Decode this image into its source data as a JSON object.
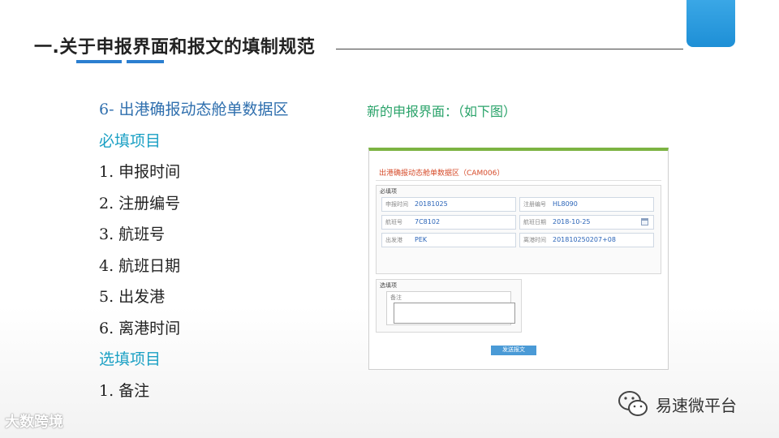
{
  "slide": {
    "title": "一.关于申报界面和报文的填制规范"
  },
  "left": {
    "heading": "6-   出港确报动态舱单数据区",
    "required_title": "必填项目",
    "required_items": [
      "1. 申报时间",
      "2. 注册编号",
      "3. 航班号",
      "4. 航班日期",
      "5. 出发港",
      "6. 离港时间"
    ],
    "optional_title": "选填项目",
    "optional_items": [
      "1. 备注"
    ]
  },
  "right": {
    "caption": "新的申报界面：（如下图）"
  },
  "form": {
    "title": "出港确报动态舱单数据区（CAM006）",
    "required_label": "必填项",
    "fields": [
      {
        "label": "申报时间",
        "value": "20181025"
      },
      {
        "label": "注册编号",
        "value": "HL8090"
      },
      {
        "label": "航班号",
        "value": "7C8102"
      },
      {
        "label": "航班日期",
        "value": "2018-10-25"
      },
      {
        "label": "出发港",
        "value": "PEK"
      },
      {
        "label": "离港时间",
        "value": "201810250207+08"
      }
    ],
    "optional_label": "选填项",
    "memo_label": "备注",
    "memo_value": "",
    "send_button": "发送报文"
  },
  "watermarks": {
    "left": "大数跨境",
    "right": "易速微平台"
  },
  "colors": {
    "accent_blue": "#2b7fd0",
    "section_teal": "#1aa0c4",
    "caption_green": "#2aa36a",
    "form_top_bar": "#7cb342",
    "form_title": "#d64b2a"
  },
  "icons": {
    "calendar": "calendar-icon",
    "wechat": "wechat-icon"
  }
}
